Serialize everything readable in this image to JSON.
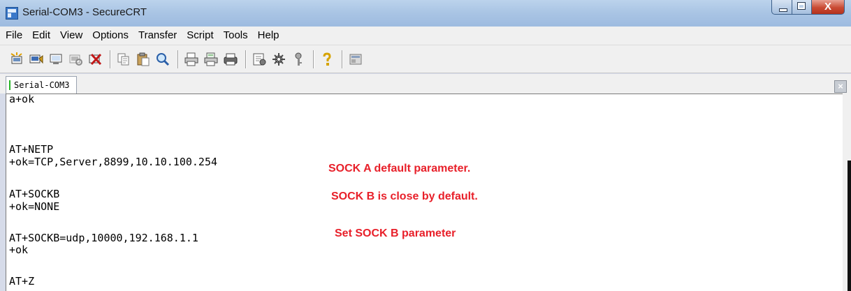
{
  "window": {
    "title": "Serial-COM3 - SecureCRT",
    "controls": {
      "close_glyph": "X"
    }
  },
  "menu": [
    "File",
    "Edit",
    "View",
    "Options",
    "Transfer",
    "Script",
    "Tools",
    "Help"
  ],
  "toolbar": {
    "icons": [
      "connect-icon",
      "quick-connect-icon",
      "connect-tab-icon",
      "reconnect-icon",
      "disconnect-icon",
      "copy-icon",
      "paste-icon",
      "find-icon",
      "print-icon",
      "print-selection-icon",
      "printer-setup-icon",
      "session-options-icon",
      "global-options-icon",
      "keymap-icon",
      "help-icon",
      "sftp-icon"
    ]
  },
  "tab": {
    "label": "Serial-COM3",
    "close_glyph": "×"
  },
  "terminal": {
    "lines": [
      "a+ok",
      "",
      "AT+NETP",
      "+ok=TCP,Server,8899,10.10.100.254",
      "",
      "AT+SOCKB",
      "+ok=NONE",
      "",
      "AT+SOCKB=udp,10000,192.168.1.1",
      "+ok",
      "",
      "AT+Z"
    ],
    "annotations": [
      "SOCK A default parameter.",
      "SOCK B is close by default.",
      "Set SOCK B parameter"
    ]
  },
  "colors": {
    "annotation": "#e8202a",
    "titlebar": "#a9c4e4"
  }
}
